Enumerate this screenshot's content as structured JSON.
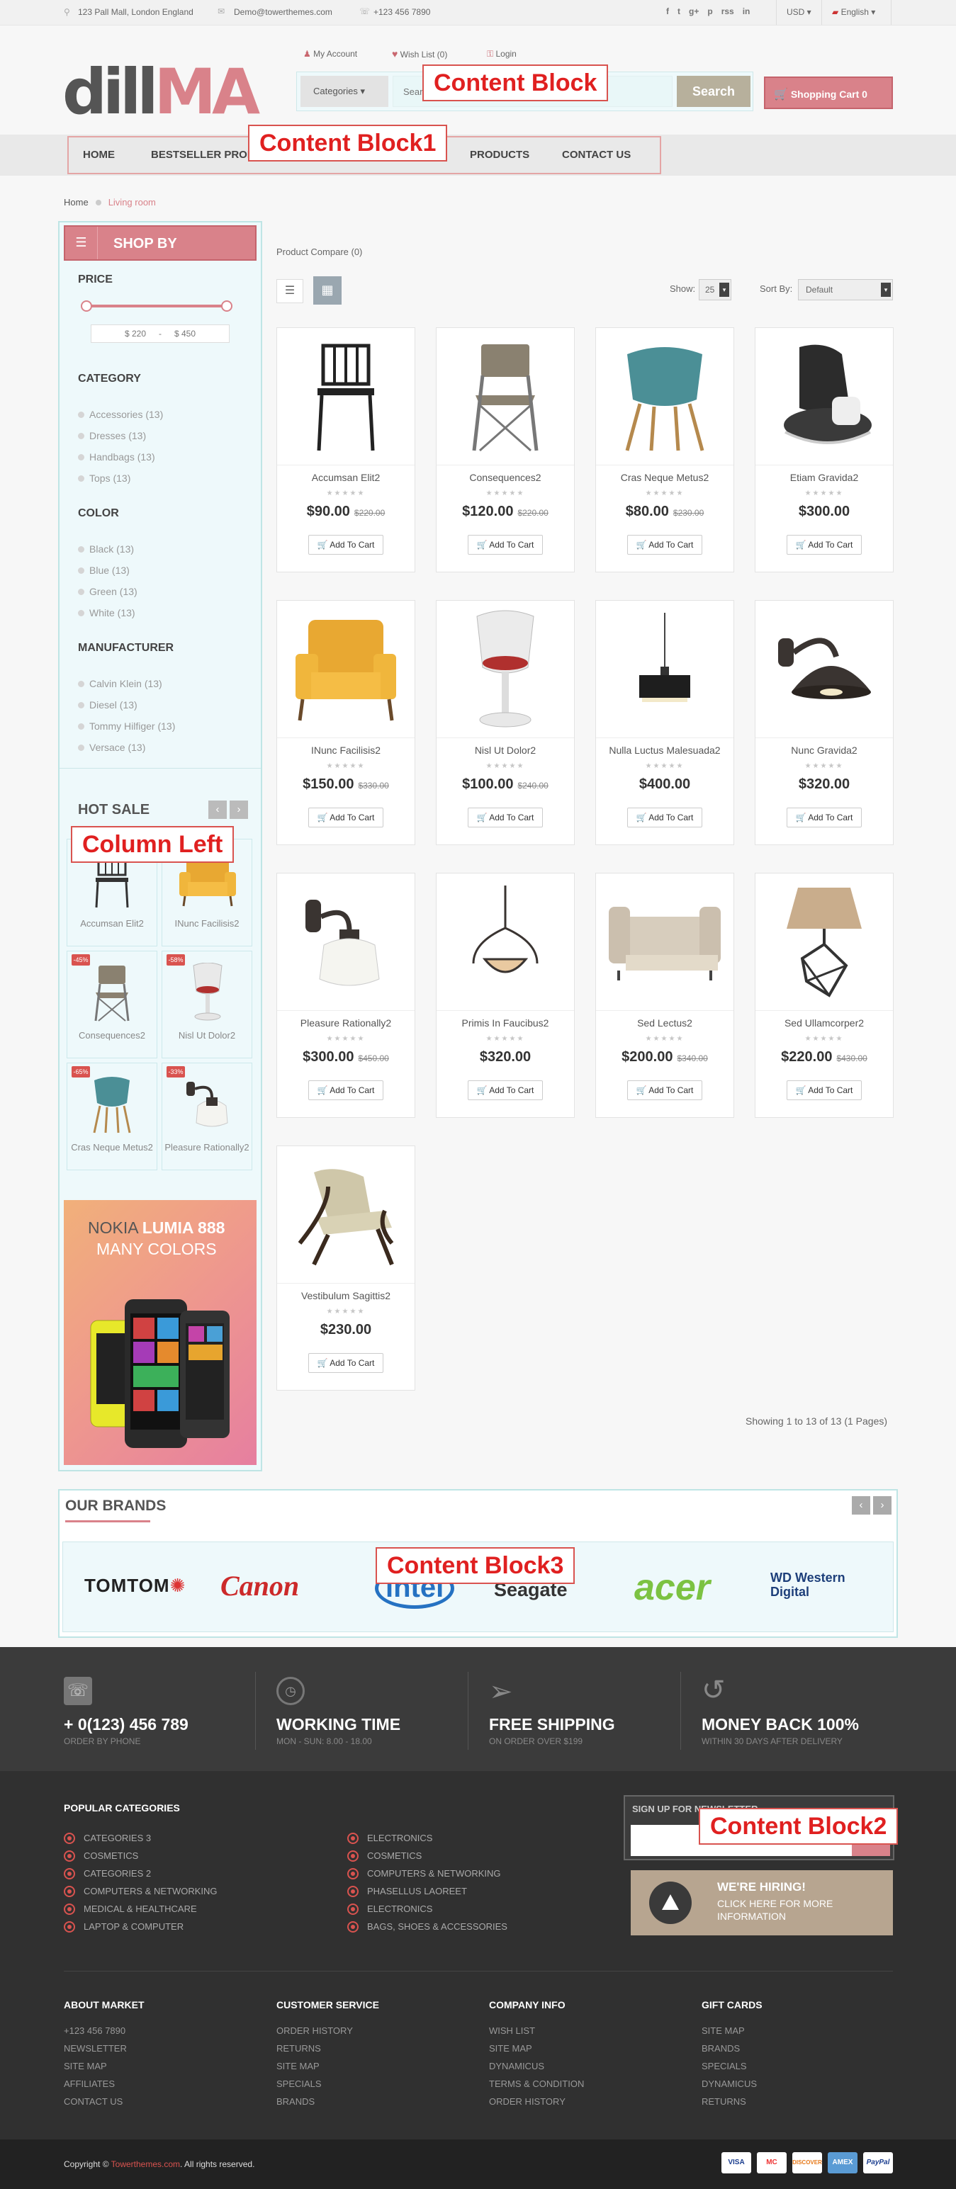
{
  "topbar": {
    "address": "123 Pall Mall, London England",
    "email": "Demo@towerthemes.com",
    "phone": "+123 456 7890",
    "social": [
      "f",
      "t",
      "g+",
      "p",
      "rss",
      "in"
    ],
    "currency": "USD",
    "language": "English"
  },
  "header": {
    "logo_text_left": "dill",
    "logo_text_right": "MA",
    "my_account": "My Account",
    "wish_list": "Wish List (0)",
    "login": "Login",
    "categories_label": "Categories",
    "search_placeholder": "Search",
    "search_button": "Search",
    "cart_label": "Shopping Cart 0"
  },
  "annotations": {
    "content_block": "Content Block",
    "content_block1": "Content Block1",
    "column_left": "Column Left",
    "content_block3": "Content Block3",
    "content_block2": "Content Block2"
  },
  "nav": {
    "items": [
      "HOME",
      "BESTSELLER PRODU",
      "PRODUCTS",
      "CONTACT US"
    ]
  },
  "breadcrumb": {
    "home": "Home",
    "current": "Living room"
  },
  "sidebar": {
    "shop_by": "SHOP BY",
    "price_title": "PRICE",
    "price_min": "$ 220",
    "price_sep": "-",
    "price_max": "$ 450",
    "category_title": "CATEGORY",
    "categories": [
      "Accessories (13)",
      "Dresses (13)",
      "Handbags (13)",
      "Tops (13)"
    ],
    "color_title": "COLOR",
    "colors": [
      "Black (13)",
      "Blue (13)",
      "Green (13)",
      "White (13)"
    ],
    "manufacturer_title": "MANUFACTURER",
    "manufacturers": [
      "Calvin Klein (13)",
      "Diesel (13)",
      "Tommy Hilfiger (13)",
      "Versace (13)"
    ],
    "hot_sale_title": "HOT SALE",
    "hot_sale": [
      {
        "name": "Accumsan Elit2",
        "badge": ""
      },
      {
        "name": "INunc Facilisis2",
        "badge": ""
      },
      {
        "name": "Consequences2",
        "badge": "-45%"
      },
      {
        "name": "Nisl Ut Dolor2",
        "badge": "-58%"
      },
      {
        "name": "Cras Neque Metus2",
        "badge": "-65%"
      },
      {
        "name": "Pleasure Rationally2",
        "badge": "-33%"
      }
    ],
    "banner_line1": "NOKIA ",
    "banner_line1b": "LUMIA 888",
    "banner_line2": "MANY COLORS"
  },
  "listing": {
    "compare": "Product Compare (0)",
    "show_label": "Show:",
    "show_value": "25",
    "sort_label": "Sort By:",
    "sort_value": "Default",
    "add_to_cart": "Add To Cart",
    "stars": "★★★★★",
    "pagination": "Showing 1 to 13 of 13 (1 Pages)"
  },
  "products": [
    {
      "name": "Accumsan Elit2",
      "price": "$90.00",
      "old": "$220.00"
    },
    {
      "name": "Consequences2",
      "price": "$120.00",
      "old": "$220.00"
    },
    {
      "name": "Cras Neque Metus2",
      "price": "$80.00",
      "old": "$230.00"
    },
    {
      "name": "Etiam Gravida2",
      "price": "$300.00",
      "old": ""
    },
    {
      "name": "INunc Facilisis2",
      "price": "$150.00",
      "old": "$330.00"
    },
    {
      "name": "Nisl Ut Dolor2",
      "price": "$100.00",
      "old": "$240.00"
    },
    {
      "name": "Nulla Luctus Malesuada2",
      "price": "$400.00",
      "old": ""
    },
    {
      "name": "Nunc Gravida2",
      "price": "$320.00",
      "old": ""
    },
    {
      "name": "Pleasure Rationally2",
      "price": "$300.00",
      "old": "$450.00"
    },
    {
      "name": "Primis In Faucibus2",
      "price": "$320.00",
      "old": ""
    },
    {
      "name": "Sed Lectus2",
      "price": "$200.00",
      "old": "$340.00"
    },
    {
      "name": "Sed Ullamcorper2",
      "price": "$220.00",
      "old": "$430.00"
    },
    {
      "name": "Vestibulum Sagittis2",
      "price": "$230.00",
      "old": ""
    }
  ],
  "brands": {
    "title": "OUR BRANDS",
    "logos": [
      "TOMTOM",
      "Canon",
      "intel",
      "Seagate",
      "acer",
      "WD Western Digital"
    ]
  },
  "services": [
    {
      "title": "+ 0(123) 456 789",
      "sub": "ORDER BY PHONE"
    },
    {
      "title": "WORKING TIME",
      "sub": "MON - SUN: 8.00 - 18.00"
    },
    {
      "title": "FREE SHIPPING",
      "sub": "ON ORDER OVER $199"
    },
    {
      "title": "MONEY BACK 100%",
      "sub": "WITHIN 30 DAYS AFTER DELIVERY"
    }
  ],
  "popular": {
    "title": "POPULAR CATEGORIES",
    "col1": [
      "CATEGORIES 3",
      "COSMETICS",
      "CATEGORIES 2",
      "COMPUTERS & NETWORKING",
      "MEDICAL & HEALTHCARE",
      "LAPTOP & COMPUTER"
    ],
    "col2": [
      "ELECTRONICS",
      "COSMETICS",
      "COMPUTERS & NETWORKING",
      "PHASELLUS LAOREET",
      "ELECTRONICS",
      "BAGS, SHOES & ACCESSORIES"
    ]
  },
  "newsletter": {
    "title": "SIGN UP FOR NEWSLETTER"
  },
  "hiring": {
    "title": "WE'RE HIRING!",
    "sub": "CLICK HERE FOR MORE INFORMATION"
  },
  "footer_cols": [
    {
      "title": "ABOUT MARKET",
      "links": [
        "+123 456 7890",
        "NEWSLETTER",
        "SITE MAP",
        "AFFILIATES",
        "CONTACT US"
      ]
    },
    {
      "title": "CUSTOMER SERVICE",
      "links": [
        "ORDER HISTORY",
        "RETURNS",
        "SITE MAP",
        "SPECIALS",
        "BRANDS"
      ]
    },
    {
      "title": "COMPANY INFO",
      "links": [
        "WISH LIST",
        "SITE MAP",
        "DYNAMICUS",
        "TERMS & CONDITION",
        "ORDER HISTORY"
      ]
    },
    {
      "title": "GIFT CARDS",
      "links": [
        "SITE MAP",
        "BRANDS",
        "SPECIALS",
        "DYNAMICUS",
        "RETURNS"
      ]
    }
  ],
  "copyright": {
    "prefix": "Copyright © ",
    "site": "Towerthemes.com",
    "suffix": ". All rights reserved."
  },
  "payments": [
    "VISA",
    "MC",
    "DISCOVER",
    "AMEX",
    "PayPal"
  ],
  "colors": {
    "accent": "#d9828a",
    "accent_dark": "#c9676f",
    "teal_border": "#bfe5e5",
    "teal_bg": "#eef9fb",
    "footer_dark": "#303030"
  }
}
